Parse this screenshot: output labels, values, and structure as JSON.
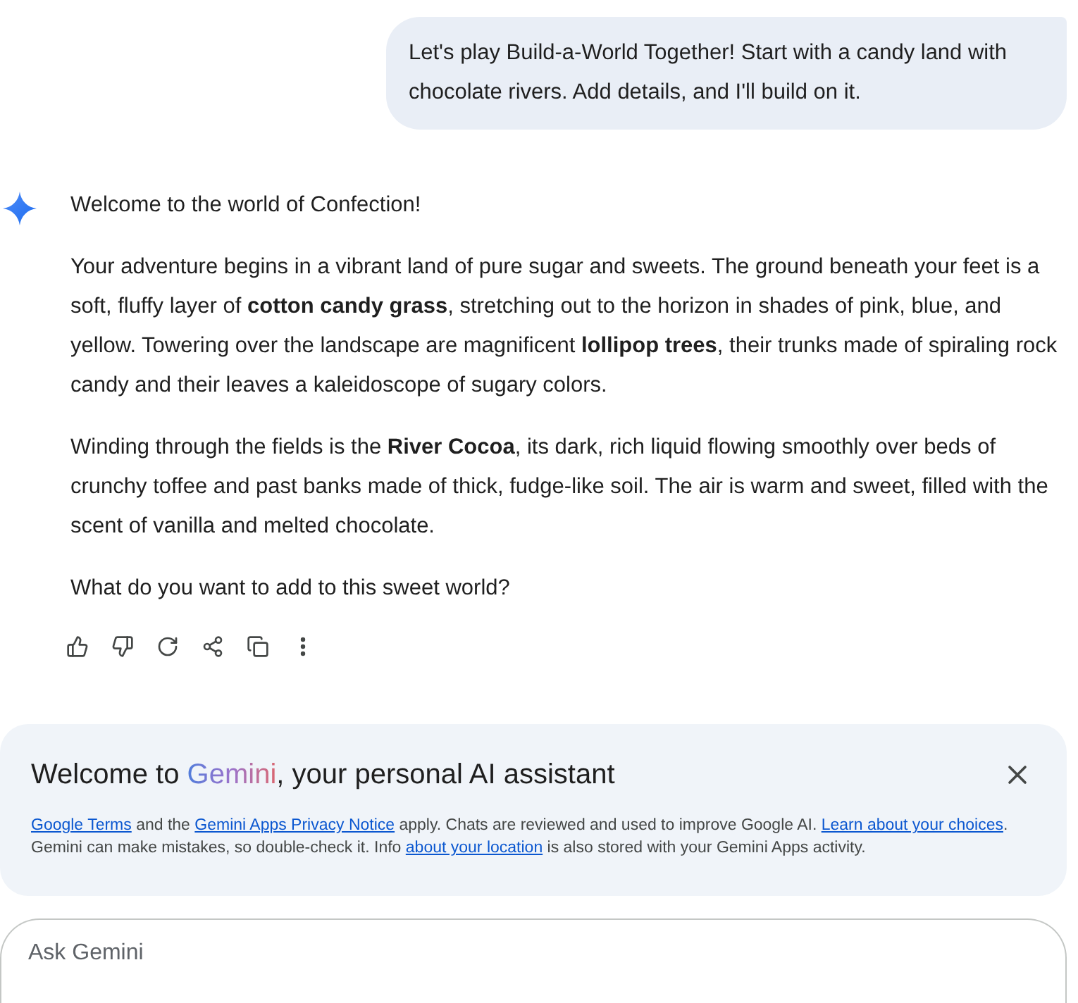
{
  "user_message": {
    "text": "Let's play Build-a-World Together! Start with a candy land with chocolate rivers. Add details, and I'll build on it."
  },
  "response": {
    "paragraphs": [
      "Welcome to the world of Confection!",
      "Your adventure begins in a vibrant land of pure sugar and sweets. The ground beneath your feet is a soft, fluffy layer of **cotton candy grass**, stretching out to the horizon in shades of pink, blue, and yellow. Towering over the landscape are magnificent **lollipop trees**, their trunks made of spiraling rock candy and their leaves a kaleidoscope of sugary colors.",
      "Winding through the fields is the **River Cocoa**, its dark, rich liquid flowing smoothly over beds of crunchy toffee and past banks made of thick, fudge-like soil. The air is warm and sweet, filled with the scent of vanilla and melted chocolate.",
      "What do you want to add to this sweet world?"
    ],
    "actions": [
      {
        "kind": "thumb-up"
      },
      {
        "kind": "thumb-down"
      },
      {
        "kind": "redo"
      },
      {
        "kind": "share"
      },
      {
        "kind": "copy"
      },
      {
        "kind": "more"
      }
    ]
  },
  "notice": {
    "title_before": "Welcome to ",
    "title_brand": "Gemini",
    "title_after": ", your personal AI assistant",
    "segments": [
      {
        "kind": "link",
        "text": "Google Terms"
      },
      {
        "kind": "text",
        "text": " and the "
      },
      {
        "kind": "link",
        "text": "Gemini Apps Privacy Notice"
      },
      {
        "kind": "text",
        "text": " apply. Chats are reviewed and used to improve Google AI. "
      },
      {
        "kind": "link",
        "text": "Learn about your choices"
      },
      {
        "kind": "text",
        "text": ". Gemini can make mistakes, so double-check it. Info "
      },
      {
        "kind": "link",
        "text": "about your location"
      },
      {
        "kind": "text",
        "text": " is also stored with your Gemini Apps activity."
      }
    ]
  },
  "input": {
    "placeholder": "Ask Gemini"
  }
}
